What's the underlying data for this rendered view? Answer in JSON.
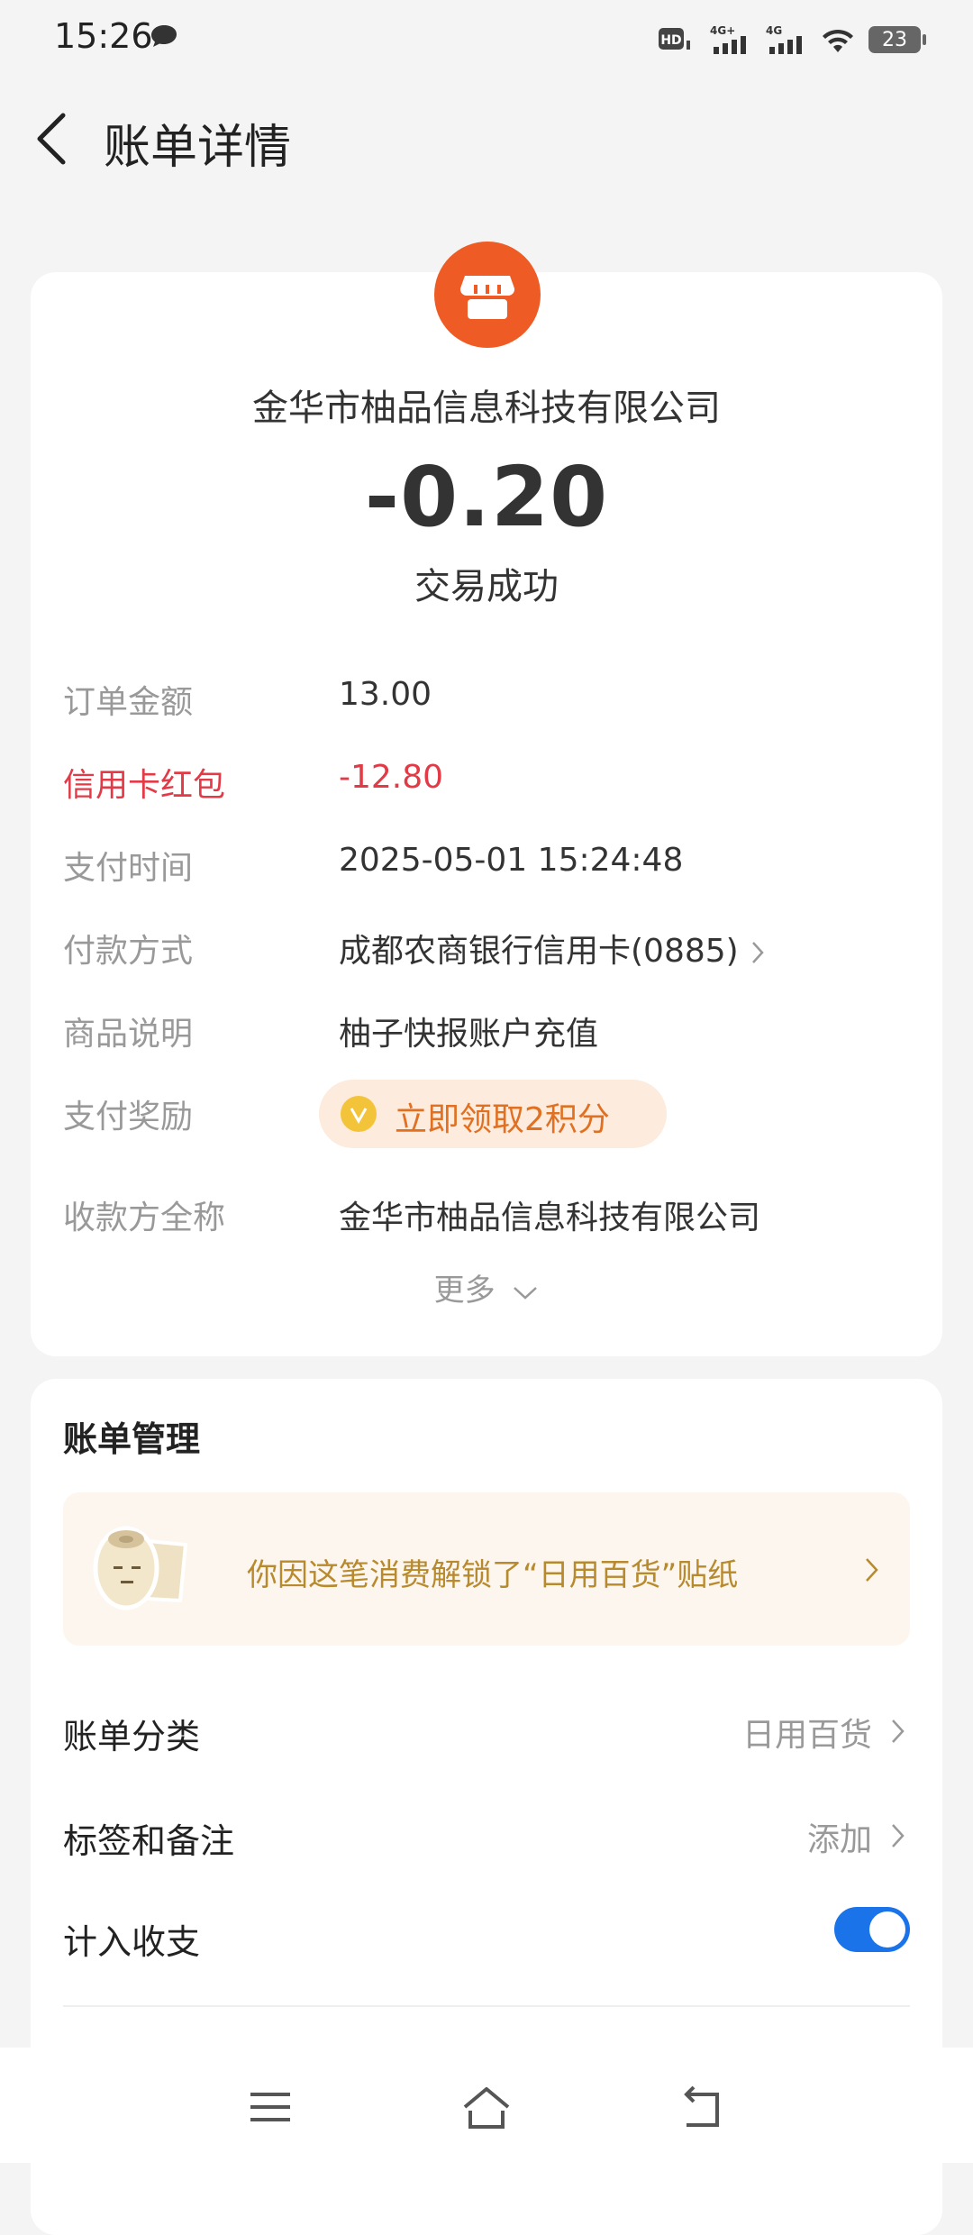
{
  "status_bar": {
    "time": "15:26",
    "battery": "23"
  },
  "header": {
    "title": "账单详情"
  },
  "transaction": {
    "merchant": "金华市柚品信息科技有限公司",
    "amount": "-0.20",
    "status": "交易成功"
  },
  "details": [
    {
      "label": "订单金额",
      "value": "13.00"
    },
    {
      "label": "信用卡红包",
      "value": "-12.80"
    },
    {
      "label": "支付时间",
      "value": "2025-05-01 15:24:48"
    },
    {
      "label": "付款方式",
      "value": "成都农商银行信用卡(0885)"
    },
    {
      "label": "商品说明",
      "value": "柚子快报账户充值"
    },
    {
      "label": "支付奖励",
      "value": "立即领取2积分"
    },
    {
      "label": "收款方全称",
      "value": "金华市柚品信息科技有限公司"
    }
  ],
  "more_label": "更多",
  "management": {
    "title": "账单管理",
    "sticker_banner": "你因这笔消费解锁了“日用百货”贴纸",
    "category": {
      "label": "账单分类",
      "value": "日用百货"
    },
    "tags": {
      "label": "标签和备注",
      "value": "添加"
    },
    "include": {
      "label": "计入收支",
      "on": true
    }
  },
  "colors": {
    "accent": "#1a73e8",
    "merchant_icon": "#ef5b24",
    "highlight": "#e23a46",
    "reward": "#e07022"
  }
}
